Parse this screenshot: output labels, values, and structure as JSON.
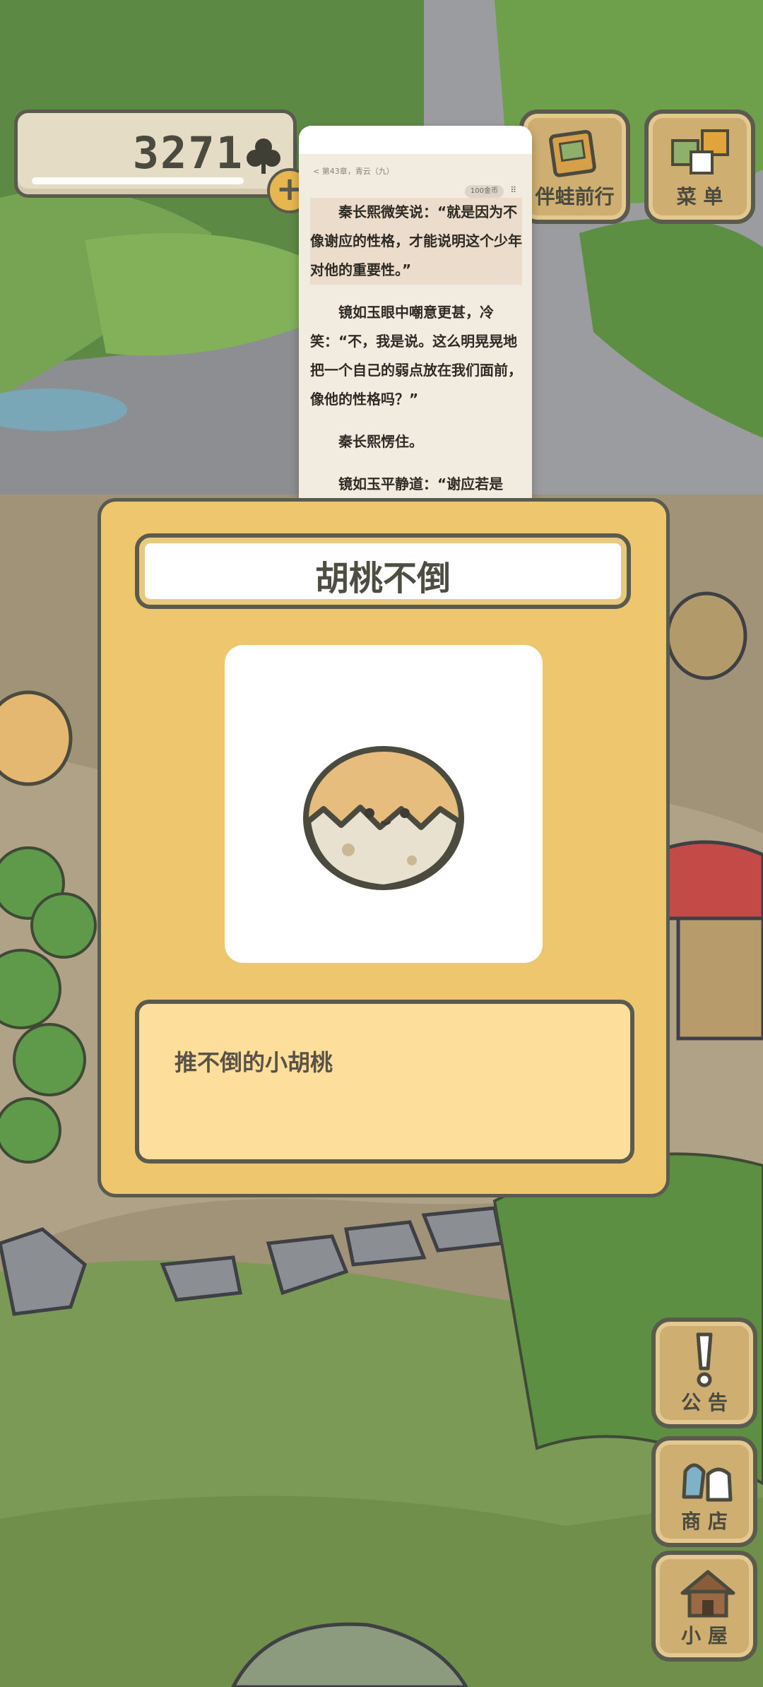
{
  "hud": {
    "clover_count": "3271",
    "plus_label": "+"
  },
  "top_buttons": {
    "companion_label": "伴蛙前行",
    "menu_label": "菜 单"
  },
  "reader": {
    "chapter": "< 第43章，青云（九）",
    "coin": "100金币",
    "paragraphs": [
      "秦长熙微笑说：“就是因为不像谢应的性格，才能说明这个少年对他的重要性。”",
      "镜如玉眼中嘲意更甚，冷笑：“不，我是说。这么明晃晃地把一个自己的弱点放在我们面前，像他的性格吗？”",
      "秦长熙愣住。",
      "镜如玉平静道：“谢应若是"
    ]
  },
  "item_card": {
    "title": "胡桃不倒",
    "description": "推不倒的小胡桃"
  },
  "side_buttons": {
    "notice_label": "公 告",
    "shop_label": "商 店",
    "house_label": "小 屋"
  },
  "icons": [
    "clover-icon",
    "plus-icon",
    "book-icon",
    "menu-icon",
    "walnut-icon",
    "exclamation-icon",
    "shop-bag-icon",
    "house-icon"
  ]
}
